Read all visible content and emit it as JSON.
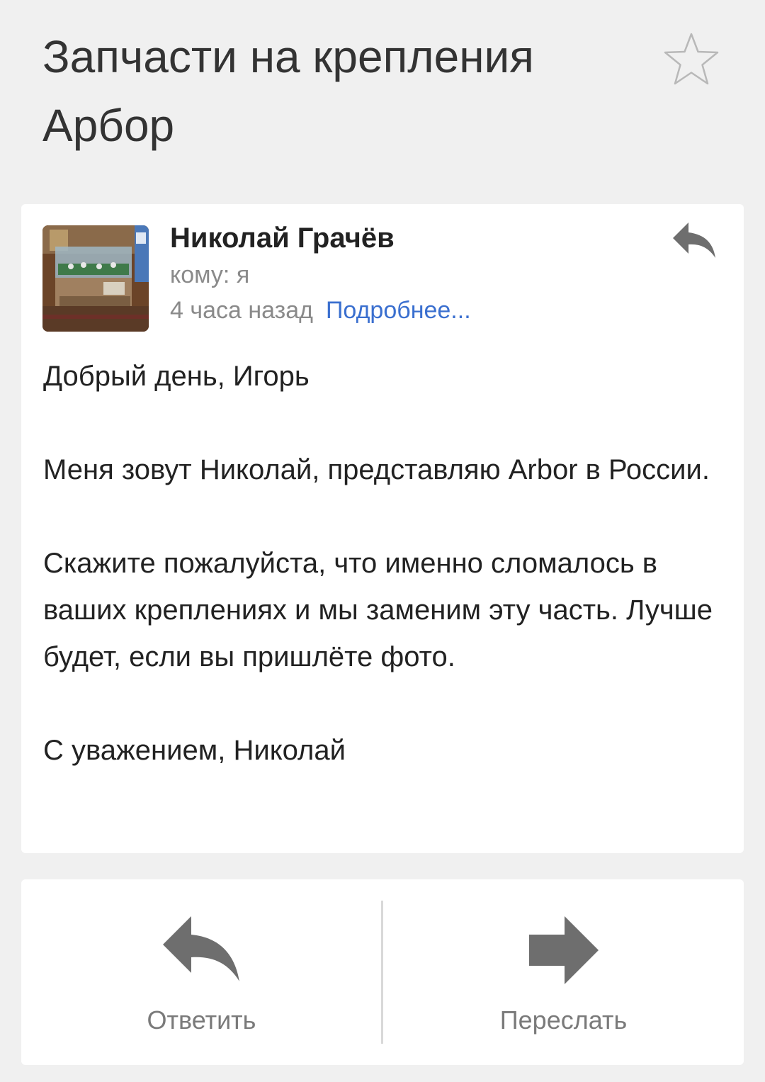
{
  "subject": "Запчасти на крепления Арбор",
  "message": {
    "sender": "Николай Грачёв",
    "to": "кому: я",
    "time": "4 часа назад",
    "details_link": "Подробнее...",
    "body": [
      "Добрый день, Игорь",
      "Меня зовут Николай, представляю Arbor в России.",
      "Скажите пожалуйста, что именно сломалось в ваших креплениях и мы заменим эту часть. Лучше будет, если вы пришлёте фото.",
      "С уважением, Николай"
    ]
  },
  "actions": {
    "reply_label": "Ответить",
    "forward_label": "Переслать"
  },
  "icons": {
    "star": "star-outline-icon",
    "reply": "reply-icon",
    "forward": "forward-icon"
  },
  "colors": {
    "link": "#3a6fcf",
    "icon": "#6e6e6e",
    "background": "#f0f0f0"
  }
}
